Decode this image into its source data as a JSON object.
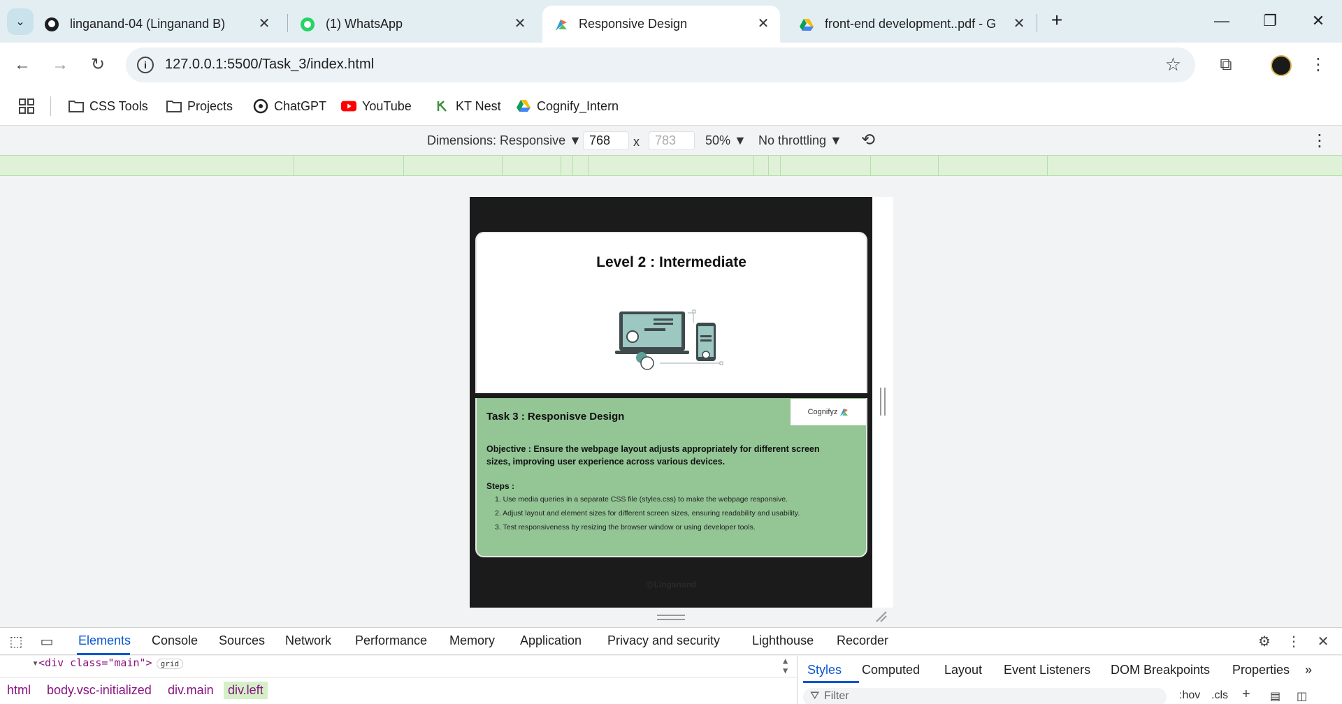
{
  "tabs": [
    {
      "title": "linganand-04 (Linganand B)",
      "icon": "github-icon"
    },
    {
      "title": "(1) WhatsApp",
      "icon": "whatsapp-icon"
    },
    {
      "title": "Responsive Design",
      "icon": "cognifyz-icon",
      "active": true
    },
    {
      "title": "front-end development..pdf - G",
      "icon": "google-drive-icon"
    }
  ],
  "toolbar": {
    "url": "127.0.0.1:5500/Task_3/index.html"
  },
  "bookmarks": [
    {
      "label": "CSS Tools",
      "icon": "folder-icon"
    },
    {
      "label": "Projects",
      "icon": "folder-icon"
    },
    {
      "label": "ChatGPT",
      "icon": "chatgpt-icon"
    },
    {
      "label": "YouTube",
      "icon": "youtube-icon"
    },
    {
      "label": "KT Nest",
      "icon": "ktnest-icon"
    },
    {
      "label": "Cognify_Intern",
      "icon": "google-drive-icon"
    }
  ],
  "device_toolbar": {
    "dimensions_label": "Dimensions: Responsive ▼",
    "width": "768",
    "height_placeholder": "783",
    "times": "x",
    "zoom": "50% ▼",
    "throttling": "No throttling ▼"
  },
  "page": {
    "level_title": "Level 2 : Intermediate",
    "logo_text": "Cognifyz",
    "task_title": "Task 3 : Responisve Design",
    "objective": "Objective : Ensure the webpage layout adjusts appropriately for different screen sizes, improving user experience across various devices.",
    "steps_title": "Steps :",
    "steps": [
      "1. Use media queries in a separate CSS file (styles.css) to make the webpage responsive.",
      "2. Adjust layout and element sizes for different screen sizes, ensuring readability and usability.",
      "3. Test responsiveness by resizing the browser window or using developer tools."
    ],
    "credit": "@Linganand"
  },
  "devtools": {
    "tabs": [
      "Elements",
      "Console",
      "Sources",
      "Network",
      "Performance",
      "Memory",
      "Application",
      "Privacy and security",
      "Lighthouse",
      "Recorder"
    ],
    "dom_line": "<div class=\"main\">",
    "dom_badge": "grid",
    "breadcrumbs": [
      "html",
      "body.vsc-initialized",
      "div.main",
      "div.left"
    ],
    "side_tabs": [
      "Styles",
      "Computed",
      "Layout",
      "Event Listeners",
      "DOM Breakpoints",
      "Properties"
    ],
    "filter_placeholder": "Filter",
    "hov": ":hov",
    "cls": ".cls"
  },
  "colors": {
    "accent": "#0b57d0",
    "card_green": "#93c595",
    "device_bg": "#1b1b1b"
  }
}
